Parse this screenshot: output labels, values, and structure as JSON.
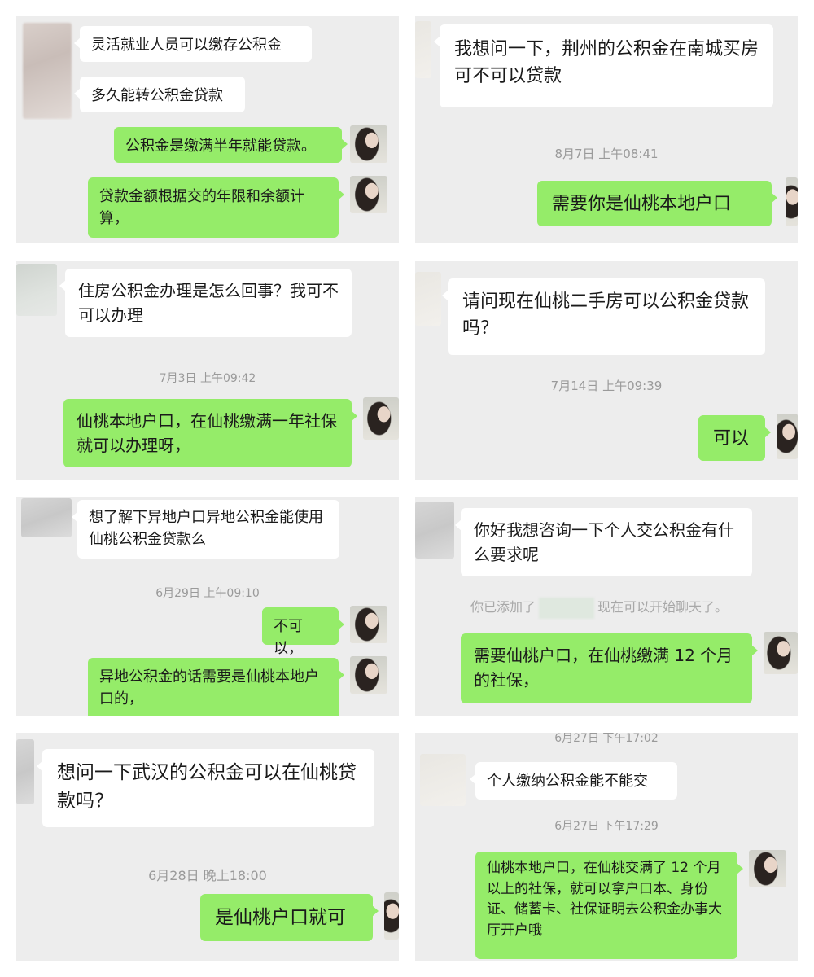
{
  "panels": {
    "p1": {
      "msgs": [
        "灵活就业人员可以缴存公积金",
        "多久能转公积金贷款",
        "公积金是缴满半年就能贷款。",
        "贷款金额根据交的年限和余额计算，"
      ]
    },
    "p2": {
      "msgs": [
        "我想问一下，荆州的公积金在南城买房可不可以贷款",
        "需要你是仙桃本地户口"
      ],
      "time": "8月7日 上午08:41"
    },
    "p3": {
      "msgs": [
        "住房公积金办理是怎么回事？我可不可以办理",
        "仙桃本地户口，在仙桃缴满一年社保就可以办理呀，"
      ],
      "time": "7月3日 上午09:42"
    },
    "p4": {
      "msgs": [
        "请问现在仙桃二手房可以公积金贷款吗？",
        "可以"
      ],
      "time": "7月14日 上午09:39"
    },
    "p5": {
      "msgs": [
        "想了解下异地户口异地公积金能使用仙桃公积金贷款么",
        "不可以，",
        "异地公积金的话需要是仙桃本地户口的，"
      ],
      "time": "6月29日 上午09:10"
    },
    "p6": {
      "msgs": [
        "你好我想咨询一下个人交公积金有什么要求呢",
        "需要仙桃户口，在仙桃缴满 12 个月的社保，"
      ],
      "sys_prefix": "你已添加了",
      "sys_suffix": "现在可以开始聊天了。"
    },
    "p7": {
      "msgs": [
        "想问一下武汉的公积金可以在仙桃贷款吗？",
        "是仙桃户口就可"
      ],
      "time": "6月28日 晚上18:00"
    },
    "p8": {
      "msgs": [
        "个人缴纳公积金能不能交",
        "仙桃本地户口，在仙桃交满了 12 个月以上的社保，就可以拿户口本、身份证、储蓄卡、社保证明去公积金办事大厅开户哦"
      ],
      "time_top": "6月27日 下午17:02",
      "time": "6月27日 下午17:29"
    }
  },
  "colors": {
    "panel_bg": "#ededed",
    "outgoing_bubble": "#95ec69",
    "incoming_bubble": "#ffffff",
    "timestamp": "#9a9a9a"
  }
}
